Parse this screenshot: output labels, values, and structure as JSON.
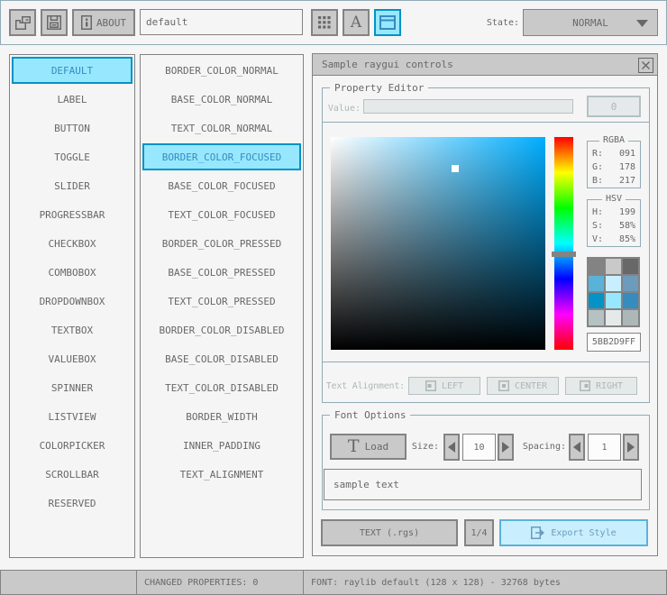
{
  "toolbar": {
    "about_label": "ABOUT",
    "style_name_value": "default",
    "state_label": "State:",
    "state_value": "NORMAL"
  },
  "controls_list": {
    "items": [
      "DEFAULT",
      "LABEL",
      "BUTTON",
      "TOGGLE",
      "SLIDER",
      "PROGRESSBAR",
      "CHECKBOX",
      "COMBOBOX",
      "DROPDOWNBOX",
      "TEXTBOX",
      "VALUEBOX",
      "SPINNER",
      "LISTVIEW",
      "COLORPICKER",
      "SCROLLBAR",
      "RESERVED"
    ],
    "selected_index": 0
  },
  "properties_list": {
    "items": [
      "BORDER_COLOR_NORMAL",
      "BASE_COLOR_NORMAL",
      "TEXT_COLOR_NORMAL",
      "BORDER_COLOR_FOCUSED",
      "BASE_COLOR_FOCUSED",
      "TEXT_COLOR_FOCUSED",
      "BORDER_COLOR_PRESSED",
      "BASE_COLOR_PRESSED",
      "TEXT_COLOR_PRESSED",
      "BORDER_COLOR_DISABLED",
      "BASE_COLOR_DISABLED",
      "TEXT_COLOR_DISABLED",
      "BORDER_WIDTH",
      "INNER_PADDING",
      "TEXT_ALIGNMENT"
    ],
    "selected_index": 3
  },
  "sample_window": {
    "title": "Sample raygui controls",
    "property_editor": {
      "title": "Property Editor",
      "value_label": "Value:",
      "value_button_label": "0",
      "rgba": {
        "title": "RGBA",
        "rows": [
          {
            "label": "R:",
            "value": "091"
          },
          {
            "label": "G:",
            "value": "178"
          },
          {
            "label": "B:",
            "value": "217"
          }
        ]
      },
      "hsv": {
        "title": "HSV",
        "rows": [
          {
            "label": "H:",
            "value": "199"
          },
          {
            "label": "S:",
            "value": "58%"
          },
          {
            "label": "V:",
            "value": "85%"
          }
        ]
      },
      "hue": 199,
      "saturation": 58,
      "value": 85,
      "hex_value": "5BB2D9FF",
      "alignment_label": "Text Alignment:",
      "alignment_options": [
        "LEFT",
        "CENTER",
        "RIGHT"
      ],
      "palette": [
        [
          "#838383",
          "#c9c9c9",
          "#686868"
        ],
        [
          "#5bb2d9",
          "#c9effe",
          "#6c9bbc"
        ],
        [
          "#0492c7",
          "#97e8ff",
          "#368bbf"
        ],
        [
          "#b5c1c2",
          "#e6e9e9",
          "#aeb7b8"
        ]
      ]
    },
    "font_options": {
      "title": "Font Options",
      "load_label": "Load",
      "size_label": "Size:",
      "size_value": "10",
      "spacing_label": "Spacing:",
      "spacing_value": "1",
      "sample_text": "sample text"
    },
    "export": {
      "format_label": "TEXT (.rgs)",
      "pager_label": "1/4",
      "export_label": "Export Style"
    }
  },
  "statusbar": {
    "changed_text": "CHANGED PROPERTIES: 0",
    "font_text": "FONT: raylib default (128 x 128) - 32768 bytes"
  },
  "colors": {
    "background": "#f5f5f5",
    "frame_line": "#90abb5",
    "border_normal": "#838383",
    "base_normal": "#c9c9c9",
    "text_normal": "#686868",
    "border_focused": "#5bb2d9",
    "base_focused": "#c9effe",
    "text_focused": "#6c9bbc",
    "border_pressed": "#0492c7",
    "base_pressed": "#97e8ff",
    "text_pressed": "#368bbf",
    "border_disabled": "#b5c1c2",
    "base_disabled": "#e6e9e9",
    "text_disabled": "#aeb7b8"
  }
}
